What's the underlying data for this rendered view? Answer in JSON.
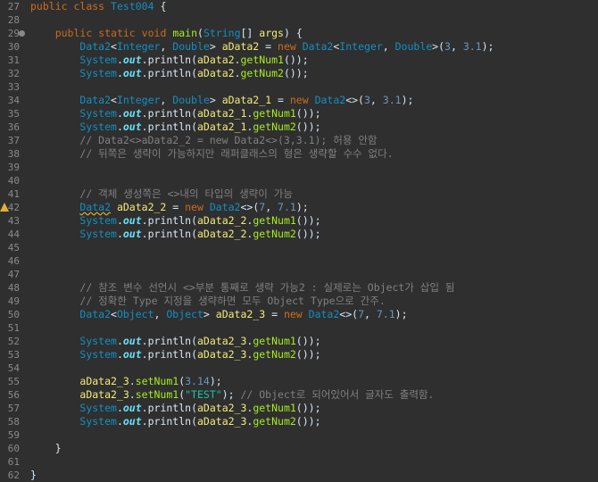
{
  "editor": {
    "lines": [
      {
        "no": "27",
        "tokens": [
          {
            "c": "kw",
            "t": "public"
          },
          {
            "c": "plain",
            "t": " "
          },
          {
            "c": "kw",
            "t": "class"
          },
          {
            "c": "plain",
            "t": " "
          },
          {
            "c": "cls",
            "t": "Test004"
          },
          {
            "c": "plain",
            "t": " {"
          }
        ]
      },
      {
        "no": "28",
        "tokens": []
      },
      {
        "no": "29",
        "fold": true,
        "tokens": [
          {
            "c": "plain",
            "t": "    "
          },
          {
            "c": "kw",
            "t": "public"
          },
          {
            "c": "plain",
            "t": " "
          },
          {
            "c": "kw",
            "t": "static"
          },
          {
            "c": "plain",
            "t": " "
          },
          {
            "c": "kw",
            "t": "void"
          },
          {
            "c": "plain",
            "t": " "
          },
          {
            "c": "method",
            "t": "main"
          },
          {
            "c": "plain",
            "t": "("
          },
          {
            "c": "type",
            "t": "String"
          },
          {
            "c": "plain",
            "t": "[] "
          },
          {
            "c": "var",
            "t": "args"
          },
          {
            "c": "plain",
            "t": ") {"
          }
        ]
      },
      {
        "no": "30",
        "tokens": [
          {
            "c": "plain",
            "t": "        "
          },
          {
            "c": "type",
            "t": "Data2"
          },
          {
            "c": "plain",
            "t": "<"
          },
          {
            "c": "type",
            "t": "Integer"
          },
          {
            "c": "plain",
            "t": ", "
          },
          {
            "c": "type",
            "t": "Double"
          },
          {
            "c": "plain",
            "t": "> "
          },
          {
            "c": "var",
            "t": "aData2"
          },
          {
            "c": "plain",
            "t": " = "
          },
          {
            "c": "kw",
            "t": "new"
          },
          {
            "c": "plain",
            "t": " "
          },
          {
            "c": "type",
            "t": "Data2"
          },
          {
            "c": "plain",
            "t": "<"
          },
          {
            "c": "type",
            "t": "Integer"
          },
          {
            "c": "plain",
            "t": ", "
          },
          {
            "c": "type",
            "t": "Double"
          },
          {
            "c": "plain",
            "t": ">("
          },
          {
            "c": "num",
            "t": "3"
          },
          {
            "c": "plain",
            "t": ", "
          },
          {
            "c": "num",
            "t": "3.1"
          },
          {
            "c": "plain",
            "t": ");"
          }
        ]
      },
      {
        "no": "31",
        "tokens": [
          {
            "c": "plain",
            "t": "        "
          },
          {
            "c": "type",
            "t": "System"
          },
          {
            "c": "plain",
            "t": "."
          },
          {
            "c": "static",
            "t": "out"
          },
          {
            "c": "plain",
            "t": "."
          },
          {
            "c": "plain",
            "t": "println"
          },
          {
            "c": "plain",
            "t": "("
          },
          {
            "c": "var",
            "t": "aData2"
          },
          {
            "c": "plain",
            "t": "."
          },
          {
            "c": "method",
            "t": "getNum1"
          },
          {
            "c": "plain",
            "t": "());"
          }
        ]
      },
      {
        "no": "32",
        "tokens": [
          {
            "c": "plain",
            "t": "        "
          },
          {
            "c": "type",
            "t": "System"
          },
          {
            "c": "plain",
            "t": "."
          },
          {
            "c": "static",
            "t": "out"
          },
          {
            "c": "plain",
            "t": "."
          },
          {
            "c": "plain",
            "t": "println"
          },
          {
            "c": "plain",
            "t": "("
          },
          {
            "c": "var",
            "t": "aData2"
          },
          {
            "c": "plain",
            "t": "."
          },
          {
            "c": "method",
            "t": "getNum2"
          },
          {
            "c": "plain",
            "t": "());"
          }
        ]
      },
      {
        "no": "33",
        "tokens": []
      },
      {
        "no": "34",
        "tokens": [
          {
            "c": "plain",
            "t": "        "
          },
          {
            "c": "type",
            "t": "Data2"
          },
          {
            "c": "plain",
            "t": "<"
          },
          {
            "c": "type",
            "t": "Integer"
          },
          {
            "c": "plain",
            "t": ", "
          },
          {
            "c": "type",
            "t": "Double"
          },
          {
            "c": "plain",
            "t": "> "
          },
          {
            "c": "var",
            "t": "aData2_1"
          },
          {
            "c": "plain",
            "t": " = "
          },
          {
            "c": "kw",
            "t": "new"
          },
          {
            "c": "plain",
            "t": " "
          },
          {
            "c": "type",
            "t": "Data2"
          },
          {
            "c": "plain",
            "t": "<>("
          },
          {
            "c": "num",
            "t": "3"
          },
          {
            "c": "plain",
            "t": ", "
          },
          {
            "c": "num",
            "t": "3.1"
          },
          {
            "c": "plain",
            "t": ");"
          }
        ]
      },
      {
        "no": "35",
        "tokens": [
          {
            "c": "plain",
            "t": "        "
          },
          {
            "c": "type",
            "t": "System"
          },
          {
            "c": "plain",
            "t": "."
          },
          {
            "c": "static",
            "t": "out"
          },
          {
            "c": "plain",
            "t": "."
          },
          {
            "c": "plain",
            "t": "println"
          },
          {
            "c": "plain",
            "t": "("
          },
          {
            "c": "var",
            "t": "aData2_1"
          },
          {
            "c": "plain",
            "t": "."
          },
          {
            "c": "method",
            "t": "getNum1"
          },
          {
            "c": "plain",
            "t": "());"
          }
        ]
      },
      {
        "no": "36",
        "tokens": [
          {
            "c": "plain",
            "t": "        "
          },
          {
            "c": "type",
            "t": "System"
          },
          {
            "c": "plain",
            "t": "."
          },
          {
            "c": "static",
            "t": "out"
          },
          {
            "c": "plain",
            "t": "."
          },
          {
            "c": "plain",
            "t": "println"
          },
          {
            "c": "plain",
            "t": "("
          },
          {
            "c": "var",
            "t": "aData2_1"
          },
          {
            "c": "plain",
            "t": "."
          },
          {
            "c": "method",
            "t": "getNum2"
          },
          {
            "c": "plain",
            "t": "());"
          }
        ]
      },
      {
        "no": "37",
        "tokens": [
          {
            "c": "plain",
            "t": "        "
          },
          {
            "c": "cmt",
            "t": "// Data2<>aData2_2 = new Data2<>(3,3.1); 허용 안함"
          }
        ]
      },
      {
        "no": "38",
        "tokens": [
          {
            "c": "plain",
            "t": "        "
          },
          {
            "c": "cmt",
            "t": "// 뒤쪽은 생략이 가능하지만 래퍼클래스의 형은 생략할 수수 없다."
          }
        ]
      },
      {
        "no": "39",
        "tokens": []
      },
      {
        "no": "40",
        "tokens": []
      },
      {
        "no": "41",
        "tokens": [
          {
            "c": "plain",
            "t": "        "
          },
          {
            "c": "cmt",
            "t": "// 객체 생성쪽은 <>내의 타입의 생략이 가능"
          }
        ]
      },
      {
        "no": "42",
        "warn": true,
        "tokens": [
          {
            "c": "plain",
            "t": "        "
          },
          {
            "c": "type squig",
            "t": "Data2"
          },
          {
            "c": "plain",
            "t": " "
          },
          {
            "c": "var",
            "t": "aData2_2"
          },
          {
            "c": "plain",
            "t": " = "
          },
          {
            "c": "kw",
            "t": "new"
          },
          {
            "c": "plain",
            "t": " "
          },
          {
            "c": "type",
            "t": "Data2"
          },
          {
            "c": "plain",
            "t": "<>("
          },
          {
            "c": "num",
            "t": "7"
          },
          {
            "c": "plain",
            "t": ", "
          },
          {
            "c": "num",
            "t": "7.1"
          },
          {
            "c": "plain",
            "t": ");"
          }
        ]
      },
      {
        "no": "43",
        "tokens": [
          {
            "c": "plain",
            "t": "        "
          },
          {
            "c": "type",
            "t": "System"
          },
          {
            "c": "plain",
            "t": "."
          },
          {
            "c": "static",
            "t": "out"
          },
          {
            "c": "plain",
            "t": "."
          },
          {
            "c": "plain",
            "t": "println"
          },
          {
            "c": "plain",
            "t": "("
          },
          {
            "c": "var",
            "t": "aData2_2"
          },
          {
            "c": "plain",
            "t": "."
          },
          {
            "c": "method",
            "t": "getNum1"
          },
          {
            "c": "plain",
            "t": "());"
          }
        ]
      },
      {
        "no": "44",
        "tokens": [
          {
            "c": "plain",
            "t": "        "
          },
          {
            "c": "type",
            "t": "System"
          },
          {
            "c": "plain",
            "t": "."
          },
          {
            "c": "static",
            "t": "out"
          },
          {
            "c": "plain",
            "t": "."
          },
          {
            "c": "plain",
            "t": "println"
          },
          {
            "c": "plain",
            "t": "("
          },
          {
            "c": "var",
            "t": "aData2_2"
          },
          {
            "c": "plain",
            "t": "."
          },
          {
            "c": "method",
            "t": "getNum2"
          },
          {
            "c": "plain",
            "t": "());"
          }
        ]
      },
      {
        "no": "45",
        "tokens": []
      },
      {
        "no": "46",
        "tokens": []
      },
      {
        "no": "47",
        "tokens": []
      },
      {
        "no": "48",
        "tokens": [
          {
            "c": "plain",
            "t": "        "
          },
          {
            "c": "cmt",
            "t": "// 참조 변수 선언시 <>부분 통째로 생략 가능2 : 실제로는 Object가 삽입 됨"
          }
        ]
      },
      {
        "no": "49",
        "tokens": [
          {
            "c": "plain",
            "t": "        "
          },
          {
            "c": "cmt",
            "t": "// 정확한 Type 지정을 생략하면 모두 Object Type으로 간주."
          }
        ]
      },
      {
        "no": "50",
        "tokens": [
          {
            "c": "plain",
            "t": "        "
          },
          {
            "c": "type",
            "t": "Data2"
          },
          {
            "c": "plain",
            "t": "<"
          },
          {
            "c": "type",
            "t": "Object"
          },
          {
            "c": "plain",
            "t": ", "
          },
          {
            "c": "type",
            "t": "Object"
          },
          {
            "c": "plain",
            "t": "> "
          },
          {
            "c": "var",
            "t": "aData2_3"
          },
          {
            "c": "plain",
            "t": " = "
          },
          {
            "c": "kw",
            "t": "new"
          },
          {
            "c": "plain",
            "t": " "
          },
          {
            "c": "type",
            "t": "Data2"
          },
          {
            "c": "plain",
            "t": "<>("
          },
          {
            "c": "num",
            "t": "7"
          },
          {
            "c": "plain",
            "t": ", "
          },
          {
            "c": "num",
            "t": "7.1"
          },
          {
            "c": "plain",
            "t": ");"
          }
        ]
      },
      {
        "no": "51",
        "tokens": []
      },
      {
        "no": "52",
        "tokens": [
          {
            "c": "plain",
            "t": "        "
          },
          {
            "c": "type",
            "t": "System"
          },
          {
            "c": "plain",
            "t": "."
          },
          {
            "c": "static",
            "t": "out"
          },
          {
            "c": "plain",
            "t": "."
          },
          {
            "c": "plain",
            "t": "println"
          },
          {
            "c": "plain",
            "t": "("
          },
          {
            "c": "var",
            "t": "aData2_3"
          },
          {
            "c": "plain",
            "t": "."
          },
          {
            "c": "method",
            "t": "getNum1"
          },
          {
            "c": "plain",
            "t": "());"
          }
        ]
      },
      {
        "no": "53",
        "tokens": [
          {
            "c": "plain",
            "t": "        "
          },
          {
            "c": "type",
            "t": "System"
          },
          {
            "c": "plain",
            "t": "."
          },
          {
            "c": "static",
            "t": "out"
          },
          {
            "c": "plain",
            "t": "."
          },
          {
            "c": "plain",
            "t": "println"
          },
          {
            "c": "plain",
            "t": "("
          },
          {
            "c": "var",
            "t": "aData2_3"
          },
          {
            "c": "plain",
            "t": "."
          },
          {
            "c": "method",
            "t": "getNum2"
          },
          {
            "c": "plain",
            "t": "());"
          }
        ]
      },
      {
        "no": "54",
        "tokens": []
      },
      {
        "no": "55",
        "tokens": [
          {
            "c": "plain",
            "t": "        "
          },
          {
            "c": "var",
            "t": "aData2_3"
          },
          {
            "c": "plain",
            "t": "."
          },
          {
            "c": "method",
            "t": "setNum1"
          },
          {
            "c": "plain",
            "t": "("
          },
          {
            "c": "num",
            "t": "3.14"
          },
          {
            "c": "plain",
            "t": ");"
          }
        ]
      },
      {
        "no": "56",
        "tokens": [
          {
            "c": "plain",
            "t": "        "
          },
          {
            "c": "var",
            "t": "aData2_3"
          },
          {
            "c": "plain",
            "t": "."
          },
          {
            "c": "method",
            "t": "setNum1"
          },
          {
            "c": "plain",
            "t": "("
          },
          {
            "c": "str",
            "t": "\"TEST\""
          },
          {
            "c": "plain",
            "t": "); "
          },
          {
            "c": "cmt",
            "t": "// Object로 되어있어서 글자도 출력함."
          }
        ]
      },
      {
        "no": "57",
        "tokens": [
          {
            "c": "plain",
            "t": "        "
          },
          {
            "c": "type",
            "t": "System"
          },
          {
            "c": "plain",
            "t": "."
          },
          {
            "c": "static",
            "t": "out"
          },
          {
            "c": "plain",
            "t": "."
          },
          {
            "c": "plain",
            "t": "println"
          },
          {
            "c": "plain",
            "t": "("
          },
          {
            "c": "var",
            "t": "aData2_3"
          },
          {
            "c": "plain",
            "t": "."
          },
          {
            "c": "method",
            "t": "getNum1"
          },
          {
            "c": "plain",
            "t": "());"
          }
        ]
      },
      {
        "no": "58",
        "tokens": [
          {
            "c": "plain",
            "t": "        "
          },
          {
            "c": "type",
            "t": "System"
          },
          {
            "c": "plain",
            "t": "."
          },
          {
            "c": "static",
            "t": "out"
          },
          {
            "c": "plain",
            "t": "."
          },
          {
            "c": "plain",
            "t": "println"
          },
          {
            "c": "plain",
            "t": "("
          },
          {
            "c": "var",
            "t": "aData2_3"
          },
          {
            "c": "plain",
            "t": "."
          },
          {
            "c": "method",
            "t": "getNum2"
          },
          {
            "c": "plain",
            "t": "());"
          }
        ]
      },
      {
        "no": "59",
        "tokens": []
      },
      {
        "no": "60",
        "tokens": [
          {
            "c": "plain",
            "t": "    }"
          }
        ]
      },
      {
        "no": "61",
        "tokens": []
      },
      {
        "no": "62",
        "tokens": [
          {
            "c": "plain",
            "t": "}"
          }
        ]
      }
    ]
  },
  "colors": {
    "background": "#2f2f2f",
    "keyword": "#cc6c1d",
    "type": "#1290c3",
    "variable": "#f3ec79",
    "method": "#a7ec21",
    "number": "#6897bb",
    "string": "#17c6a3",
    "comment": "#808080",
    "static_field": "#66e1f8",
    "line_number": "#8a8a8a"
  },
  "icons": {
    "fold": "fold-collapse-icon",
    "warning": "warning-icon"
  }
}
